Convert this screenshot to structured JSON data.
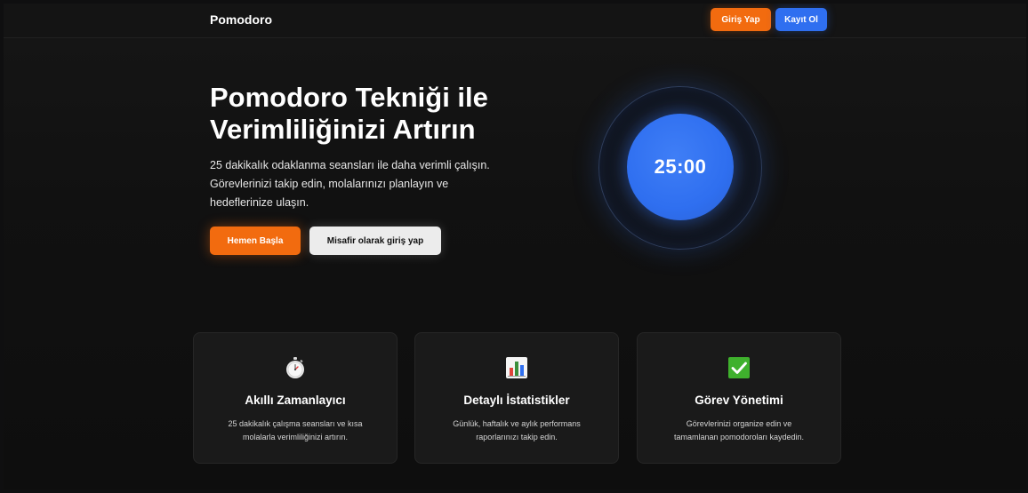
{
  "header": {
    "brand": "Pomodoro",
    "login_label": "Giriş Yap",
    "register_label": "Kayıt Ol"
  },
  "hero": {
    "title_lines": [
      "Pomodoro Tekniği ile",
      "Verimliliğinizi Artırın"
    ],
    "description_lines": [
      "25 dakikalık odaklanma seansları ile daha verimli çalışın.",
      "Görevlerinizi takip edin, molalarınızı planlayın ve",
      "hedeflerinize ulaşın."
    ],
    "start_label": "Hemen Başla",
    "guest_label": "Misafir olarak giriş yap"
  },
  "timer": {
    "display": "25:00"
  },
  "features": [
    {
      "icon": "stopwatch-icon",
      "title": "Akıllı Zamanlayıcı",
      "desc_lines": [
        "25 dakikalık çalışma seansları ve kısa",
        "molalarla verimliliğinizi artırın."
      ]
    },
    {
      "icon": "bar-chart-icon",
      "title": "Detaylı İstatistikler",
      "desc_lines": [
        "Günlük, haftalık ve aylık performans",
        "raporlarınızı takip edin."
      ]
    },
    {
      "icon": "check-mark-icon",
      "title": "Görev Yönetimi",
      "desc_lines": [
        "Görevlerinizi organize edin ve",
        "tamamlanan pomodoroları kaydedin."
      ]
    }
  ],
  "colors": {
    "accent_orange": "#f26b0f",
    "accent_blue": "#2f6ff0",
    "background": "#111111"
  }
}
